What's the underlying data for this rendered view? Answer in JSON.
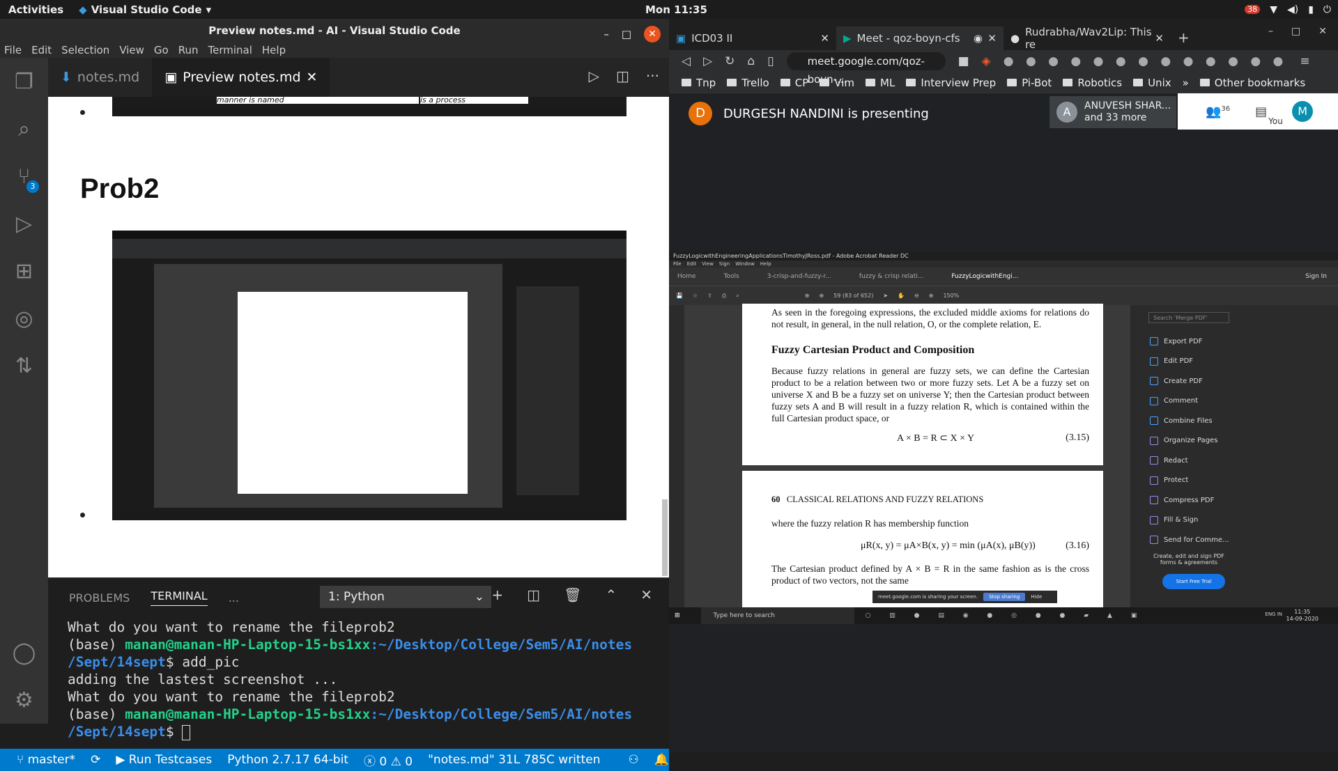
{
  "topbar": {
    "activities": "Activities",
    "app": "Visual Studio Code",
    "clock": "Mon 11:35",
    "notif_count": "38"
  },
  "vscode": {
    "window_title": "Preview notes.md - AI - Visual Studio Code",
    "menu": [
      "File",
      "Edit",
      "Selection",
      "View",
      "Go",
      "Run",
      "Terminal",
      "Help"
    ],
    "scm_badge": "3",
    "tabs": {
      "notes": "notes.md",
      "preview": "Preview notes.md"
    },
    "preview": {
      "heading": "Prob2",
      "top_snippet_left": "manner is named",
      "top_snippet_right": "is a process"
    },
    "panel": {
      "problems": "PROBLEMS",
      "terminal": "TERMINAL",
      "more": "...",
      "selector": "1: Python"
    },
    "terminal": {
      "l1": "What do you want to rename the fileprob2",
      "base": "(base) ",
      "user": "manan@manan-HP-Laptop-15-bs1xx",
      "path": ":~/Desktop/College/Sem5/AI/notes",
      "path2": "/Sept/14sept",
      "cmd": "$ add_pic",
      "l4": "adding the lastest screenshot ...",
      "l5": "What do you want to rename the fileprob2",
      "prompt_end": "$ "
    },
    "status": {
      "branch": "master*",
      "run": "Run Testcases",
      "python": "Python 2.7.17 64-bit",
      "errors": "0",
      "warnings": "0",
      "file": "\"notes.md\" 31L 785C written"
    }
  },
  "browser": {
    "tabs": [
      {
        "label": "ICD03 II"
      },
      {
        "label": "Meet - qoz-boyn-cfs"
      },
      {
        "label": "Rudrabha/Wav2Lip: This re"
      }
    ],
    "url": "meet.google.com/qoz-boyn-...",
    "bookmarks": [
      "Tnp",
      "Trello",
      "CP",
      "Vim",
      "ML",
      "Interview Prep",
      "Pi-Bot",
      "Robotics",
      "Unix"
    ],
    "other_bookmarks": "Other bookmarks",
    "meet": {
      "presenter_initial": "D",
      "presenting": "DURGESH NANDINI is presenting",
      "participant_initial": "A",
      "participant_name": "ANUVESH SHAR...",
      "participant_more": "and 33 more",
      "people_count": "36",
      "you": "You",
      "me_initial": "M"
    }
  },
  "acrobat": {
    "title": "FuzzyLogicwithEngineeringApplicationsTimothyJRoss.pdf - Adobe Acrobat Reader DC",
    "menu": [
      "File",
      "Edit",
      "View",
      "Sign",
      "Window",
      "Help"
    ],
    "tabs": [
      "Home",
      "Tools",
      "3-crisp-and-fuzzy-r...",
      "fuzzy & crisp relati...",
      "FuzzyLogicwithEngi..."
    ],
    "signin": "Sign In",
    "page_info": "59  (83 of 652)",
    "zoom": "150%",
    "page1_top": "As seen in the foregoing expressions, the excluded middle axioms for relations do not result, in general, in the null relation, O, or the complete relation, E.",
    "section_title": "Fuzzy Cartesian Product and Composition",
    "para": "Because fuzzy relations in general are fuzzy sets, we can define the Cartesian product to be a relation between two or more fuzzy sets. Let A be a fuzzy set on universe X and B be a fuzzy set on universe Y; then the Cartesian product between fuzzy sets A and B will result in a fuzzy relation R, which is contained within the full Cartesian product space, or",
    "eq1": "A × B = R ⊂ X × Y",
    "eq1_num": "(3.15)",
    "page2_num": "60",
    "page2_header": "CLASSICAL RELATIONS AND FUZZY RELATIONS",
    "page2_line": "where the fuzzy relation R has membership function",
    "eq2": "μR(x, y) = μA×B(x, y) = min (μA(x), μB(y))",
    "eq2_num": "(3.16)",
    "page2_tail": "The Cartesian product defined by A × B = R in the same fashion as is the cross product of two vectors, not the same",
    "search_placeholder": "Search 'Merge PDF'",
    "tools": [
      "Export PDF",
      "Edit PDF",
      "Create PDF",
      "Comment",
      "Combine Files",
      "Organize Pages",
      "Redact",
      "Protect",
      "Compress PDF",
      "Fill & Sign",
      "Send for Comme..."
    ],
    "create_note": "Create, edit and sign PDF forms & agreements",
    "trial": "Start Free Trial",
    "share_text": "meet.google.com is sharing your screen.",
    "stop_sharing": "Stop sharing",
    "hide": "Hide",
    "win_search": "Type here to search",
    "win_time": "11:35",
    "win_date": "14-09-2020",
    "win_lang": "ENG IN"
  }
}
